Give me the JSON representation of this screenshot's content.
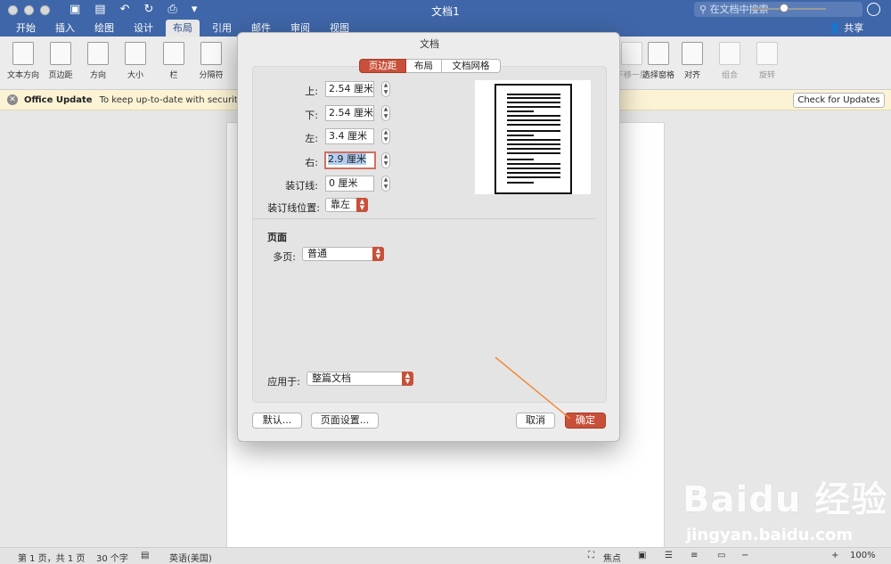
{
  "window": {
    "title": "文档1"
  },
  "search": {
    "placeholder": "在文档中搜索"
  },
  "share_label": "共享",
  "tabs": [
    "开始",
    "插入",
    "绘图",
    "设计",
    "布局",
    "引用",
    "邮件",
    "审阅",
    "视图"
  ],
  "active_tab": "布局",
  "ribbon": {
    "items": [
      "文本方向",
      "页边距",
      "方向",
      "大小",
      "栏",
      "分隔符"
    ],
    "right_items": [
      "下移一层",
      "选择窗格",
      "对齐",
      "组合",
      "旋转"
    ]
  },
  "infobar": {
    "title": "Office Update",
    "message": "To keep up-to-date with security upda",
    "button": "Check for Updates"
  },
  "dialog": {
    "title": "文档",
    "tabs": [
      "页边距",
      "布局",
      "文档网格"
    ],
    "active_tab": "页边距",
    "margins": [
      {
        "label": "上:",
        "value": "2.54 厘米"
      },
      {
        "label": "下:",
        "value": "2.54 厘米"
      },
      {
        "label": "左:",
        "value": "3.4 厘米"
      },
      {
        "label": "右:",
        "value": "2.9 厘米"
      },
      {
        "label": "装订线:",
        "value": "0 厘米"
      }
    ],
    "gutter_position": {
      "label": "装订线位置:",
      "value": "靠左"
    },
    "pages_section": {
      "title": "页面",
      "label": "多页:",
      "value": "普通"
    },
    "apply_to": {
      "label": "应用于:",
      "value": "整篇文档"
    },
    "buttons": {
      "default": "默认...",
      "page_setup": "页面设置...",
      "cancel": "取消",
      "ok": "确定"
    }
  },
  "statusbar": {
    "page": "第 1 页，共 1 页",
    "words": "30 个字",
    "language": "英语(美国)",
    "focus": "焦点",
    "zoom": "100%",
    "zoom_fraction": 0.44
  },
  "watermark": {
    "main": "Baidu 经验",
    "sub": "jingyan.baidu.com"
  }
}
